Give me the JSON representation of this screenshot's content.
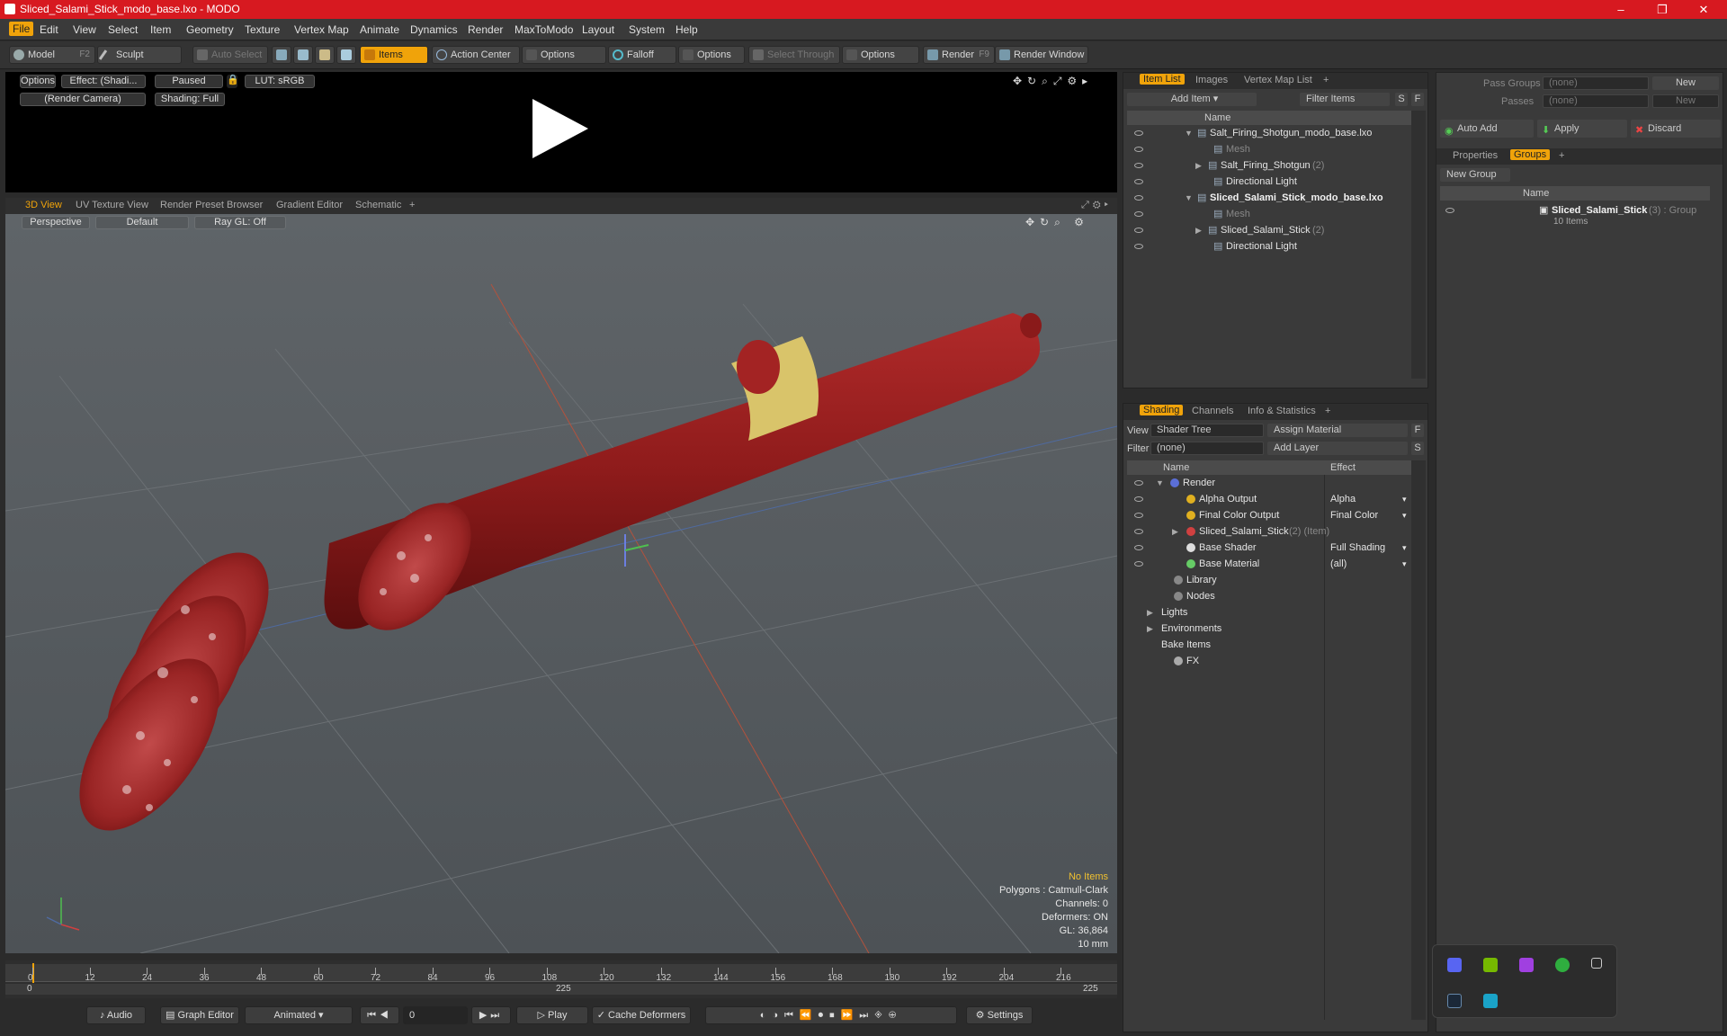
{
  "window": {
    "title": "Sliced_Salami_Stick_modo_base.lxo - MODO",
    "minimize": "–",
    "maximize": "❐",
    "close": "✕"
  },
  "menu": [
    "File",
    "Edit",
    "View",
    "Select",
    "Item",
    "Geometry",
    "Texture",
    "Vertex Map",
    "Animate",
    "Dynamics",
    "Render",
    "MaxToModo",
    "Layout",
    "System",
    "Help"
  ],
  "toolbar": {
    "model": "Model",
    "model_key": "F2",
    "sculpt": "Sculpt",
    "auto_select": "Auto Select",
    "items": "Items",
    "action_center": "Action Center",
    "options1": "Options",
    "falloff": "Falloff",
    "options2": "Options",
    "select_through": "Select Through",
    "options3": "Options",
    "render": "Render",
    "render_key": "F9",
    "render_window": "Render Window"
  },
  "preview": {
    "options": "Options",
    "effect": "Effect: (Shadi...",
    "paused": "Paused",
    "lut": "LUT: sRGB",
    "camera": "(Render Camera)",
    "shading": "Shading: Full"
  },
  "viewport_tabs": [
    "3D View",
    "UV Texture View",
    "Render Preset Browser",
    "Gradient Editor",
    "Schematic",
    "+"
  ],
  "viewport": {
    "perspective": "Perspective",
    "default": "Default",
    "raygl": "Ray GL: Off",
    "stats": [
      "No Items",
      "Polygons : Catmull-Clark",
      "Channels: 0",
      "Deformers: ON",
      "GL: 36,864",
      "10 mm"
    ]
  },
  "timeline": {
    "ticks": [
      "0",
      "12",
      "24",
      "36",
      "48",
      "60",
      "72",
      "84",
      "96",
      "108",
      "120",
      "132",
      "144",
      "156",
      "168",
      "180",
      "192",
      "204",
      "216"
    ],
    "start": "0",
    "mid": "225",
    "end": "225"
  },
  "bottombar": {
    "audio": "Audio",
    "graph_editor": "Graph Editor",
    "animated": "Animated",
    "frame": "0",
    "play": "Play",
    "cache_deformers": "Cache Deformers",
    "settings": "Settings"
  },
  "item_list": {
    "tabs": [
      "Item List",
      "Images",
      "Vertex Map List",
      "+"
    ],
    "add_item": "Add Item",
    "filter_items": "Filter Items",
    "s_btn": "S",
    "f_btn": "F",
    "name_header": "Name",
    "rows": [
      {
        "label": "Salt_Firing_Shotgun_modo_base.lxo",
        "suffix": "",
        "bold": false
      },
      {
        "label": "Mesh",
        "suffix": "",
        "bold": false
      },
      {
        "label": "Salt_Firing_Shotgun",
        "suffix": "(2)",
        "bold": false
      },
      {
        "label": "Directional Light",
        "suffix": "",
        "bold": false
      },
      {
        "label": "Sliced_Salami_Stick_modo_base.lxo",
        "suffix": "",
        "bold": true
      },
      {
        "label": "Mesh",
        "suffix": "",
        "bold": false
      },
      {
        "label": "Sliced_Salami_Stick",
        "suffix": "(2)",
        "bold": false
      },
      {
        "label": "Directional Light",
        "suffix": "",
        "bold": false
      }
    ]
  },
  "shading": {
    "tabs": [
      "Shading",
      "Channels",
      "Info & Statistics",
      "+"
    ],
    "view_label": "View",
    "view_value": "Shader Tree",
    "assign_material": "Assign Material",
    "filter_label": "Filter",
    "filter_value": "(none)",
    "add_layer": "Add Layer",
    "f_btn": "F",
    "s_btn": "S",
    "name_header": "Name",
    "effect_header": "Effect",
    "rows": [
      {
        "label": "Render",
        "effect": "",
        "suffix": ""
      },
      {
        "label": "Alpha Output",
        "effect": "Alpha",
        "suffix": ""
      },
      {
        "label": "Final Color Output",
        "effect": "Final Color",
        "suffix": ""
      },
      {
        "label": "Sliced_Salami_Stick",
        "effect": "",
        "suffix": "(2) (Item)"
      },
      {
        "label": "Base Shader",
        "effect": "Full Shading",
        "suffix": ""
      },
      {
        "label": "Base Material",
        "effect": "(all)",
        "suffix": ""
      },
      {
        "label": "Library",
        "effect": "",
        "suffix": ""
      },
      {
        "label": "Nodes",
        "effect": "",
        "suffix": ""
      },
      {
        "label": "Lights",
        "effect": "",
        "suffix": ""
      },
      {
        "label": "Environments",
        "effect": "",
        "suffix": ""
      },
      {
        "label": "Bake Items",
        "effect": "",
        "suffix": ""
      },
      {
        "label": "FX",
        "effect": "",
        "suffix": ""
      }
    ]
  },
  "groups": {
    "pass_groups_label": "Pass Groups",
    "pass_groups_value": "(none)",
    "new1": "New",
    "passes_label": "Passes",
    "passes_value": "(none)",
    "new2": "New",
    "auto_add": "Auto Add",
    "apply": "Apply",
    "discard": "Discard",
    "tabs": [
      "Properties",
      "Groups",
      "+"
    ],
    "new_group": "New Group",
    "name_header": "Name",
    "group_name": "Sliced_Salami_Stick",
    "group_suffix": "(3) : Group",
    "group_items": "10 Items"
  },
  "colors": {
    "accent": "#f0a30a",
    "titlebar": "#d71920",
    "salami": "#8e1b1b",
    "label_band": "#d9c46a"
  }
}
